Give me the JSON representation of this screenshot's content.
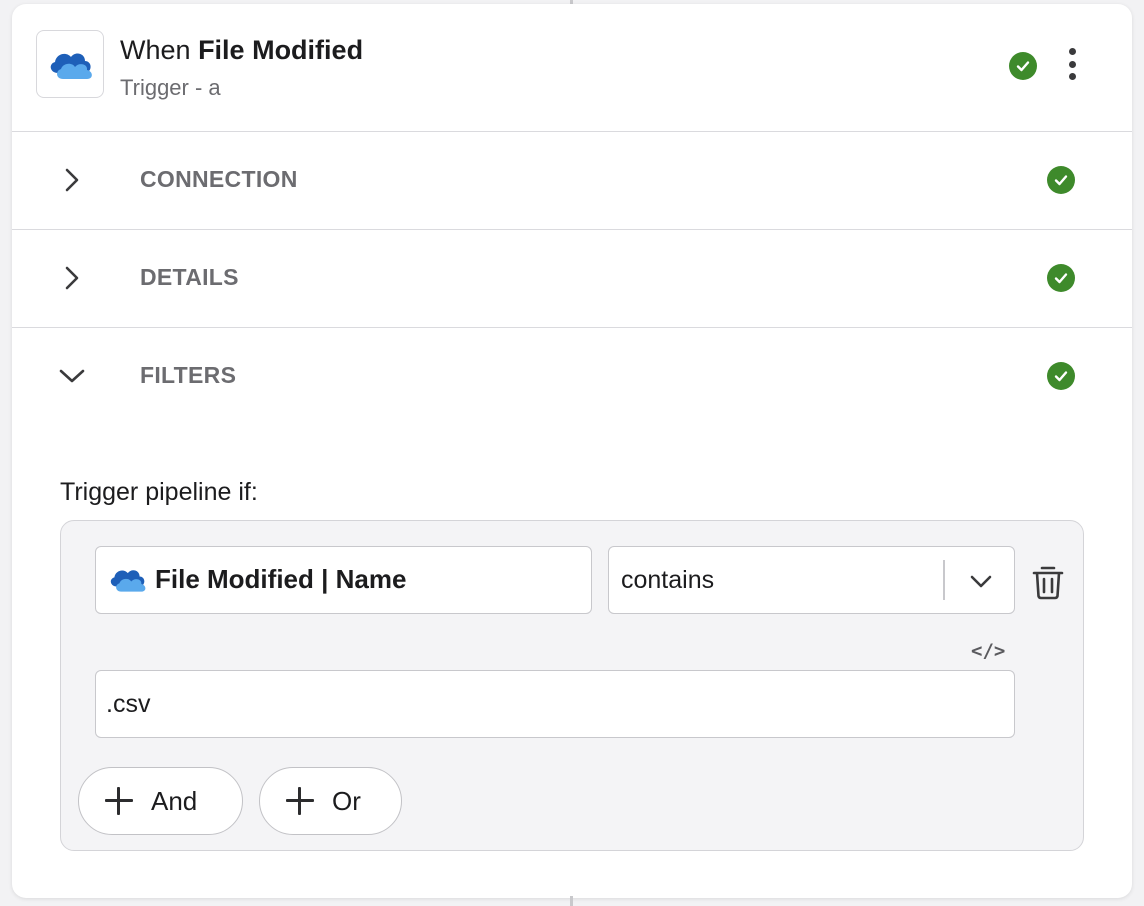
{
  "header": {
    "title_prefix": "When",
    "title_bold": "File Modified",
    "subtitle": "Trigger - a",
    "app_icon": "onedrive-cloud-icon",
    "status_icon": "check-circle-icon",
    "menu_icon": "kebab-menu-icon"
  },
  "sections": [
    {
      "label": "CONNECTION",
      "expanded": false,
      "status": "valid"
    },
    {
      "label": "DETAILS",
      "expanded": false,
      "status": "valid"
    },
    {
      "label": "FILTERS",
      "expanded": true,
      "status": "valid"
    }
  ],
  "filters": {
    "intro": "Trigger pipeline if:",
    "condition": {
      "field_label": "File Modified | Name",
      "operator": "contains",
      "value": ".csv",
      "code_toggle": "</>"
    },
    "buttons": {
      "and_label": "And",
      "or_label": "Or"
    }
  },
  "colors": {
    "success": "#3e8a2b",
    "onedrive_dark": "#1e5fb8",
    "onedrive_light": "#5aa9ec"
  }
}
